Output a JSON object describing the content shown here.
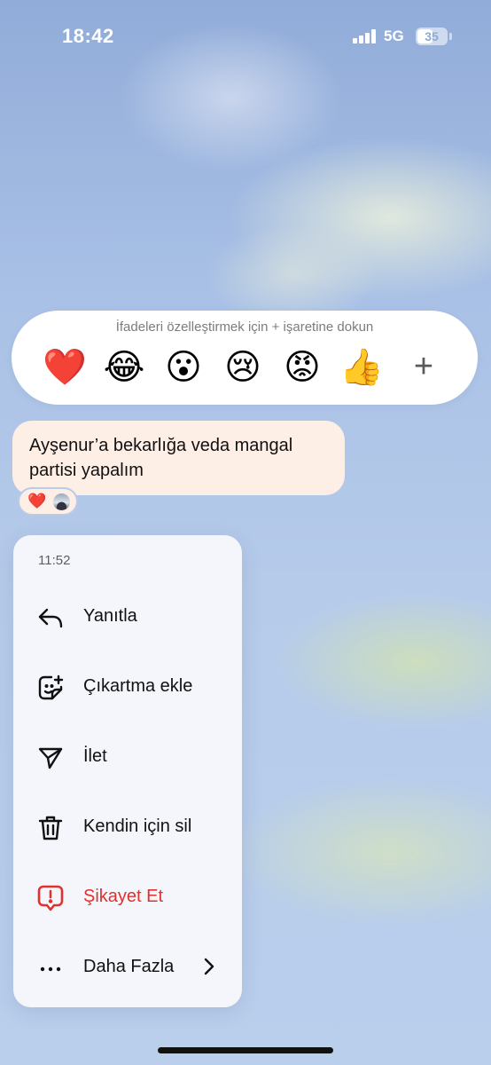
{
  "status_bar": {
    "time": "18:42",
    "network": "5G",
    "battery": "35",
    "signal_bars": 4
  },
  "reaction_bar": {
    "hint": "İfadeleri özelleştirmek için + işaretine dokun",
    "emojis": [
      {
        "name": "red-heart",
        "glyph": "❤️"
      },
      {
        "name": "face-with-tears-of-joy",
        "glyph": "😂"
      },
      {
        "name": "face-with-open-mouth",
        "glyph": "😮"
      },
      {
        "name": "crying-face",
        "glyph": "😢"
      },
      {
        "name": "pouting-face",
        "glyph": "😡"
      },
      {
        "name": "thumbs-up",
        "glyph": "👍"
      }
    ],
    "add_glyph": "+"
  },
  "message": {
    "text": "Ayşenur’a bekarlığa veda mangal partisi yapalım",
    "reaction_emoji": "❤️",
    "bubble_color": "#fdeee6"
  },
  "context_menu": {
    "time": "11:52",
    "items": [
      {
        "label": "Yanıtla",
        "icon": "reply-icon"
      },
      {
        "label": "Çıkartma ekle",
        "icon": "add-sticker-icon"
      },
      {
        "label": "İlet",
        "icon": "forward-icon"
      },
      {
        "label": "Kendin için sil",
        "icon": "trash-icon"
      },
      {
        "label": "Şikayet Et",
        "icon": "report-icon",
        "color": "#e0312d"
      },
      {
        "label": "Daha Fazla",
        "icon": "more-icon"
      }
    ]
  }
}
